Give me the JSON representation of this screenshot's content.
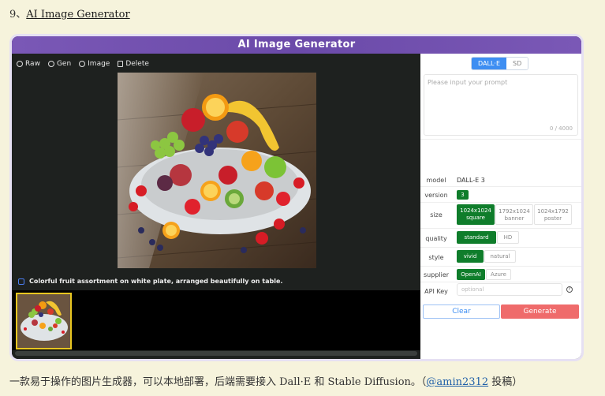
{
  "heading": {
    "number": "9、",
    "link": "AI Image Generator"
  },
  "window": {
    "title": "AI Image Generator"
  },
  "toolbar": {
    "raw": "Raw",
    "gen": "Gen",
    "image": "Image",
    "delete": "Delete"
  },
  "caption": "Colorful fruit assortment on white plate, arranged beautifully on table.",
  "panel": {
    "engine_tabs": [
      "DALL·E",
      "SD"
    ],
    "prompt_placeholder": "Please input your prompt",
    "prompt_count": "0 / 4000",
    "model_label": "model",
    "model_value": "DALL-E 3",
    "version_label": "version",
    "version_value": "3",
    "size_label": "size",
    "size_options": [
      {
        "line1": "1024x1024",
        "line2": "square"
      },
      {
        "line1": "1792x1024",
        "line2": "banner"
      },
      {
        "line1": "1024x1792",
        "line2": "poster"
      }
    ],
    "quality_label": "quality",
    "quality_options": [
      "standard",
      "HD"
    ],
    "style_label": "style",
    "style_options": [
      "vivid",
      "natural"
    ],
    "supplier_label": "supplier",
    "supplier_options": [
      "OpenAI",
      "Azure"
    ],
    "apikey_label": "API Key",
    "apikey_placeholder": "optional",
    "clear_label": "Clear",
    "generate_label": "Generate"
  },
  "footer": {
    "text": "一款易于操作的图片生成器，可以本地部署，后端需要接入 Dall·E 和 Stable Diffusion。（",
    "author": "@amin2312",
    "suffix": " 投稿）"
  },
  "colors": {
    "accent_green": "#0f7d2b",
    "accent_blue": "#3e8ef2",
    "generate_red": "#ef6b6b",
    "title_purple": "#6b4aa9"
  }
}
